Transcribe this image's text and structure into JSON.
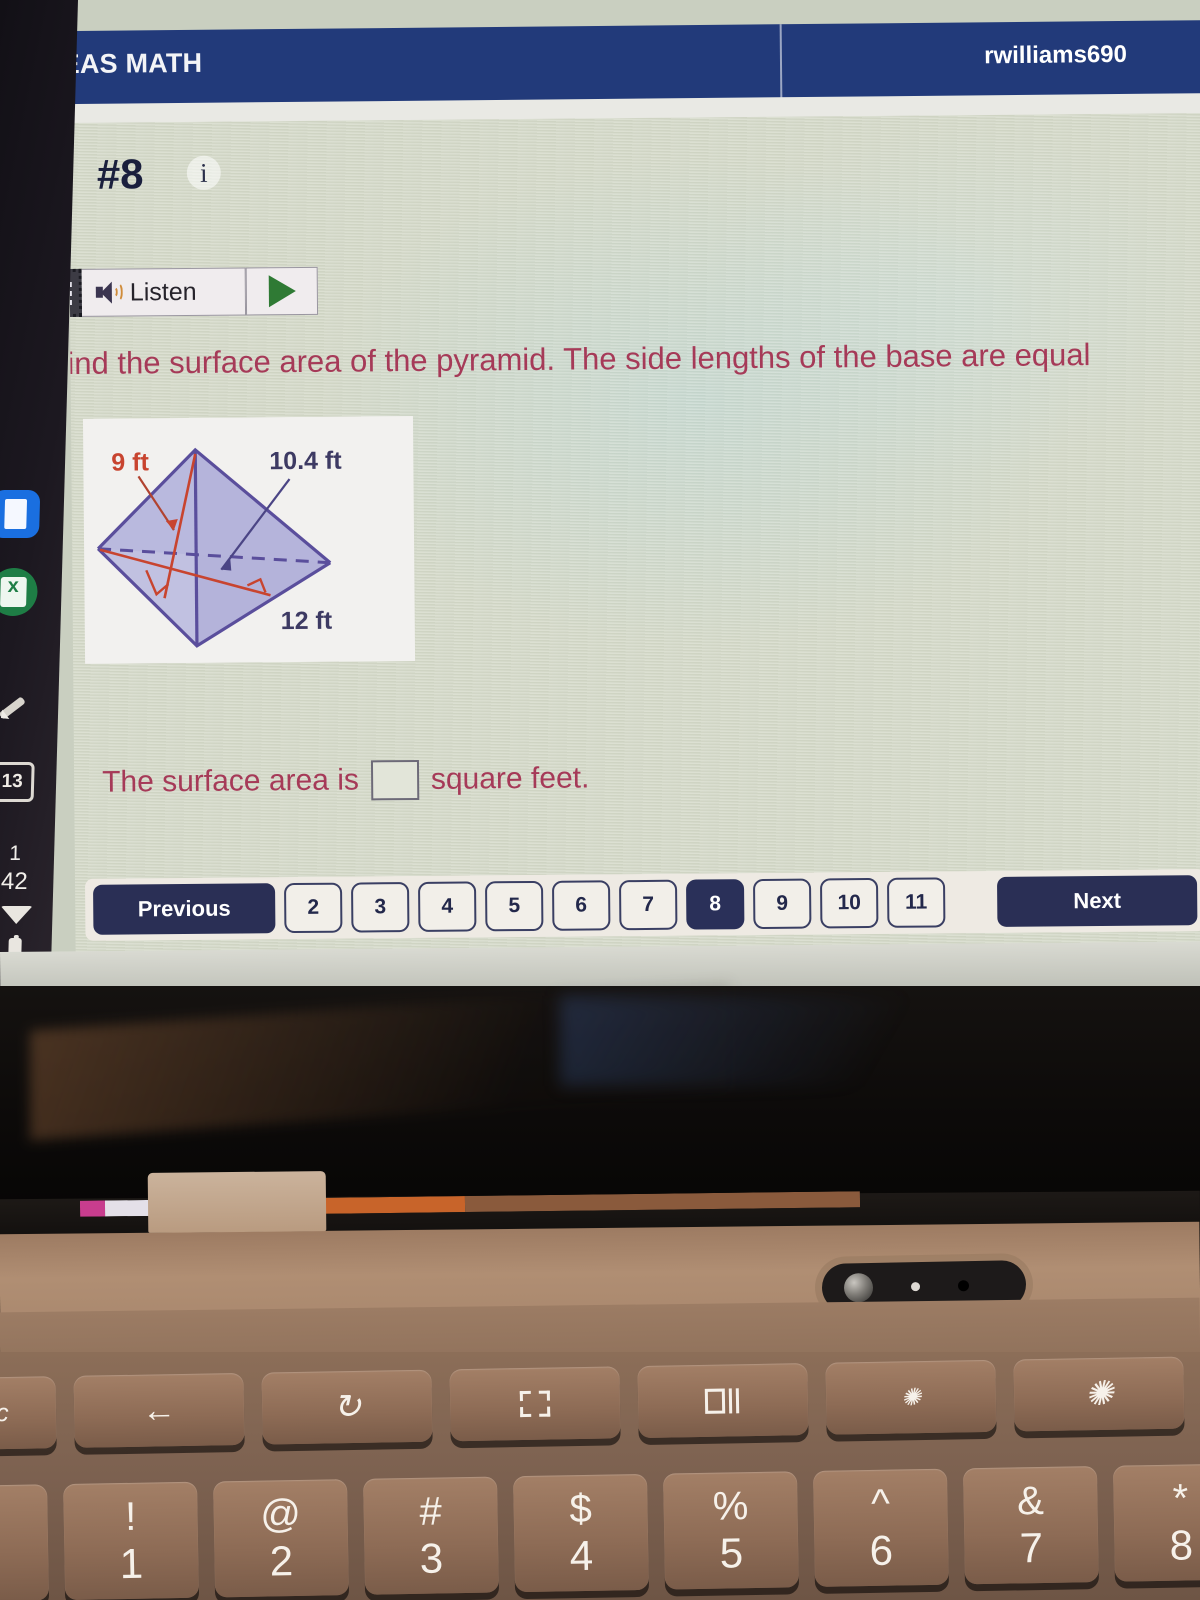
{
  "app": {
    "brand": "BIG IDEAS MATH",
    "account": "rwilliams690",
    "header_color": "#223a7a"
  },
  "question": {
    "number_label": "#8",
    "info_icon": "info-icon",
    "prompt": "Find the surface area of the pyramid. The side lengths of the base are equal",
    "prompt_color": "#a63a58"
  },
  "readspeaker": {
    "menu_icon": "readspeaker-menu-icon",
    "speaker_icon": "speaker-icon",
    "listen_label": "Listen",
    "play_icon": "play-triangle-icon"
  },
  "figure": {
    "shape": "square-pyramid",
    "labels": {
      "slant_height": "9 ft",
      "lateral_edge": "10.4 ft",
      "base_side": "12 ft"
    },
    "edge_color": "#5a4e9c",
    "measure_color": "#c8442f",
    "face_color": "#b3b2dc"
  },
  "answer": {
    "prefix": "The surface area is",
    "input_value": "",
    "suffix": "square feet."
  },
  "navigation": {
    "previous_label": "Previous",
    "next_label": "Next",
    "pages": [
      "2",
      "3",
      "4",
      "5",
      "6",
      "7",
      "8",
      "9",
      "10",
      "11"
    ],
    "active_page": "8",
    "active_color": "#2a3059"
  },
  "phone_overlay": {
    "icons": [
      "document-app-icon",
      "spreadsheet-app-icon",
      "pen-icon",
      "calendar-icon"
    ],
    "calendar_day": "13",
    "status_line1": "1",
    "status_line2": "42",
    "wifi_icon": "wifi-icon",
    "battery_icon": "battery-icon"
  },
  "keyboard": {
    "function_row": [
      {
        "label": "sc",
        "icon": "escape-key"
      },
      {
        "label": "",
        "icon": "back-arrow-icon"
      },
      {
        "label": "",
        "icon": "reload-icon"
      },
      {
        "label": "",
        "icon": "fullscreen-icon"
      },
      {
        "label": "",
        "icon": "overview-windows-icon"
      },
      {
        "label": "",
        "icon": "brightness-down-icon"
      },
      {
        "label": "",
        "icon": "brightness-up-icon"
      }
    ],
    "number_row": [
      {
        "symbol": "!",
        "digit": "1"
      },
      {
        "symbol": "@",
        "digit": "2"
      },
      {
        "symbol": "#",
        "digit": "3"
      },
      {
        "symbol": "$",
        "digit": "4"
      },
      {
        "symbol": "%",
        "digit": "5"
      },
      {
        "symbol": "^",
        "digit": "6"
      },
      {
        "symbol": "&",
        "digit": "7"
      },
      {
        "symbol": "*",
        "digit": "8"
      }
    ]
  }
}
